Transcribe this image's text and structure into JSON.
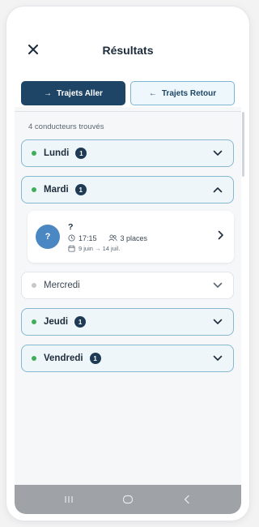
{
  "header": {
    "title": "Résultats",
    "close_icon": "close-icon"
  },
  "toggle": {
    "aller_label": "Trajets Aller",
    "aller_arrow": "→",
    "retour_label": "Trajets Retour",
    "retour_arrow": "←"
  },
  "results": {
    "count_text": "4 conducteurs trouvés"
  },
  "days": [
    {
      "label": "Lundi",
      "badge": "1",
      "available": true,
      "expanded": false
    },
    {
      "label": "Mardi",
      "badge": "1",
      "available": true,
      "expanded": true
    },
    {
      "label": "Mercredi",
      "badge": "",
      "available": false,
      "expanded": false
    },
    {
      "label": "Jeudi",
      "badge": "1",
      "available": true,
      "expanded": false
    },
    {
      "label": "Vendredi",
      "badge": "1",
      "available": true,
      "expanded": false
    }
  ],
  "trip": {
    "avatar_text": "?",
    "driver_name": "?",
    "time": "17:15",
    "places": "3 places",
    "dates": "9 juin → 14 juil."
  },
  "colors": {
    "primary": "#1e4566",
    "accent_border": "#87b8d0",
    "available_dot": "#3fae5a",
    "unavailable_dot": "#c3c8cd",
    "avatar": "#4a87c3"
  }
}
